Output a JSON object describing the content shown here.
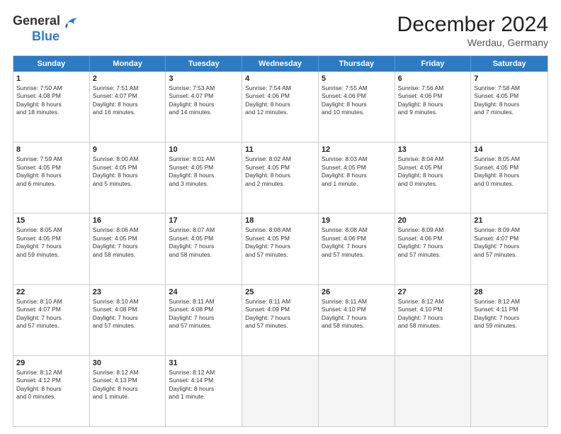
{
  "header": {
    "logo_general": "General",
    "logo_blue": "Blue",
    "month_year": "December 2024",
    "location": "Werdau, Germany"
  },
  "days_of_week": [
    "Sunday",
    "Monday",
    "Tuesday",
    "Wednesday",
    "Thursday",
    "Friday",
    "Saturday"
  ],
  "weeks": [
    [
      {
        "day": "1",
        "lines": [
          "Sunrise: 7:50 AM",
          "Sunset: 4:08 PM",
          "Daylight: 8 hours",
          "and 18 minutes."
        ]
      },
      {
        "day": "2",
        "lines": [
          "Sunrise: 7:51 AM",
          "Sunset: 4:07 PM",
          "Daylight: 8 hours",
          "and 16 minutes."
        ]
      },
      {
        "day": "3",
        "lines": [
          "Sunrise: 7:53 AM",
          "Sunset: 4:07 PM",
          "Daylight: 8 hours",
          "and 14 minutes."
        ]
      },
      {
        "day": "4",
        "lines": [
          "Sunrise: 7:54 AM",
          "Sunset: 4:06 PM",
          "Daylight: 8 hours",
          "and 12 minutes."
        ]
      },
      {
        "day": "5",
        "lines": [
          "Sunrise: 7:55 AM",
          "Sunset: 4:06 PM",
          "Daylight: 8 hours",
          "and 10 minutes."
        ]
      },
      {
        "day": "6",
        "lines": [
          "Sunrise: 7:56 AM",
          "Sunset: 4:06 PM",
          "Daylight: 8 hours",
          "and 9 minutes."
        ]
      },
      {
        "day": "7",
        "lines": [
          "Sunrise: 7:58 AM",
          "Sunset: 4:05 PM",
          "Daylight: 8 hours",
          "and 7 minutes."
        ]
      }
    ],
    [
      {
        "day": "8",
        "lines": [
          "Sunrise: 7:59 AM",
          "Sunset: 4:05 PM",
          "Daylight: 8 hours",
          "and 6 minutes."
        ]
      },
      {
        "day": "9",
        "lines": [
          "Sunrise: 8:00 AM",
          "Sunset: 4:05 PM",
          "Daylight: 8 hours",
          "and 5 minutes."
        ]
      },
      {
        "day": "10",
        "lines": [
          "Sunrise: 8:01 AM",
          "Sunset: 4:05 PM",
          "Daylight: 8 hours",
          "and 3 minutes."
        ]
      },
      {
        "day": "11",
        "lines": [
          "Sunrise: 8:02 AM",
          "Sunset: 4:05 PM",
          "Daylight: 8 hours",
          "and 2 minutes."
        ]
      },
      {
        "day": "12",
        "lines": [
          "Sunrise: 8:03 AM",
          "Sunset: 4:05 PM",
          "Daylight: 8 hours",
          "and 1 minute."
        ]
      },
      {
        "day": "13",
        "lines": [
          "Sunrise: 8:04 AM",
          "Sunset: 4:05 PM",
          "Daylight: 8 hours",
          "and 0 minutes."
        ]
      },
      {
        "day": "14",
        "lines": [
          "Sunrise: 8:05 AM",
          "Sunset: 4:05 PM",
          "Daylight: 8 hours",
          "and 0 minutes."
        ]
      }
    ],
    [
      {
        "day": "15",
        "lines": [
          "Sunrise: 8:05 AM",
          "Sunset: 4:05 PM",
          "Daylight: 7 hours",
          "and 59 minutes."
        ]
      },
      {
        "day": "16",
        "lines": [
          "Sunrise: 8:06 AM",
          "Sunset: 4:05 PM",
          "Daylight: 7 hours",
          "and 58 minutes."
        ]
      },
      {
        "day": "17",
        "lines": [
          "Sunrise: 8:07 AM",
          "Sunset: 4:05 PM",
          "Daylight: 7 hours",
          "and 58 minutes."
        ]
      },
      {
        "day": "18",
        "lines": [
          "Sunrise: 8:08 AM",
          "Sunset: 4:05 PM",
          "Daylight: 7 hours",
          "and 57 minutes."
        ]
      },
      {
        "day": "19",
        "lines": [
          "Sunrise: 8:08 AM",
          "Sunset: 4:06 PM",
          "Daylight: 7 hours",
          "and 57 minutes."
        ]
      },
      {
        "day": "20",
        "lines": [
          "Sunrise: 8:09 AM",
          "Sunset: 4:06 PM",
          "Daylight: 7 hours",
          "and 57 minutes."
        ]
      },
      {
        "day": "21",
        "lines": [
          "Sunrise: 8:09 AM",
          "Sunset: 4:07 PM",
          "Daylight: 7 hours",
          "and 57 minutes."
        ]
      }
    ],
    [
      {
        "day": "22",
        "lines": [
          "Sunrise: 8:10 AM",
          "Sunset: 4:07 PM",
          "Daylight: 7 hours",
          "and 57 minutes."
        ]
      },
      {
        "day": "23",
        "lines": [
          "Sunrise: 8:10 AM",
          "Sunset: 4:08 PM",
          "Daylight: 7 hours",
          "and 57 minutes."
        ]
      },
      {
        "day": "24",
        "lines": [
          "Sunrise: 8:11 AM",
          "Sunset: 4:08 PM",
          "Daylight: 7 hours",
          "and 57 minutes."
        ]
      },
      {
        "day": "25",
        "lines": [
          "Sunrise: 8:11 AM",
          "Sunset: 4:09 PM",
          "Daylight: 7 hours",
          "and 57 minutes."
        ]
      },
      {
        "day": "26",
        "lines": [
          "Sunrise: 8:11 AM",
          "Sunset: 4:10 PM",
          "Daylight: 7 hours",
          "and 58 minutes."
        ]
      },
      {
        "day": "27",
        "lines": [
          "Sunrise: 8:12 AM",
          "Sunset: 4:10 PM",
          "Daylight: 7 hours",
          "and 58 minutes."
        ]
      },
      {
        "day": "28",
        "lines": [
          "Sunrise: 8:12 AM",
          "Sunset: 4:11 PM",
          "Daylight: 7 hours",
          "and 59 minutes."
        ]
      }
    ],
    [
      {
        "day": "29",
        "lines": [
          "Sunrise: 8:12 AM",
          "Sunset: 4:12 PM",
          "Daylight: 8 hours",
          "and 0 minutes."
        ]
      },
      {
        "day": "30",
        "lines": [
          "Sunrise: 8:12 AM",
          "Sunset: 4:13 PM",
          "Daylight: 8 hours",
          "and 1 minute."
        ]
      },
      {
        "day": "31",
        "lines": [
          "Sunrise: 8:12 AM",
          "Sunset: 4:14 PM",
          "Daylight: 8 hours",
          "and 1 minute."
        ]
      },
      null,
      null,
      null,
      null
    ]
  ]
}
